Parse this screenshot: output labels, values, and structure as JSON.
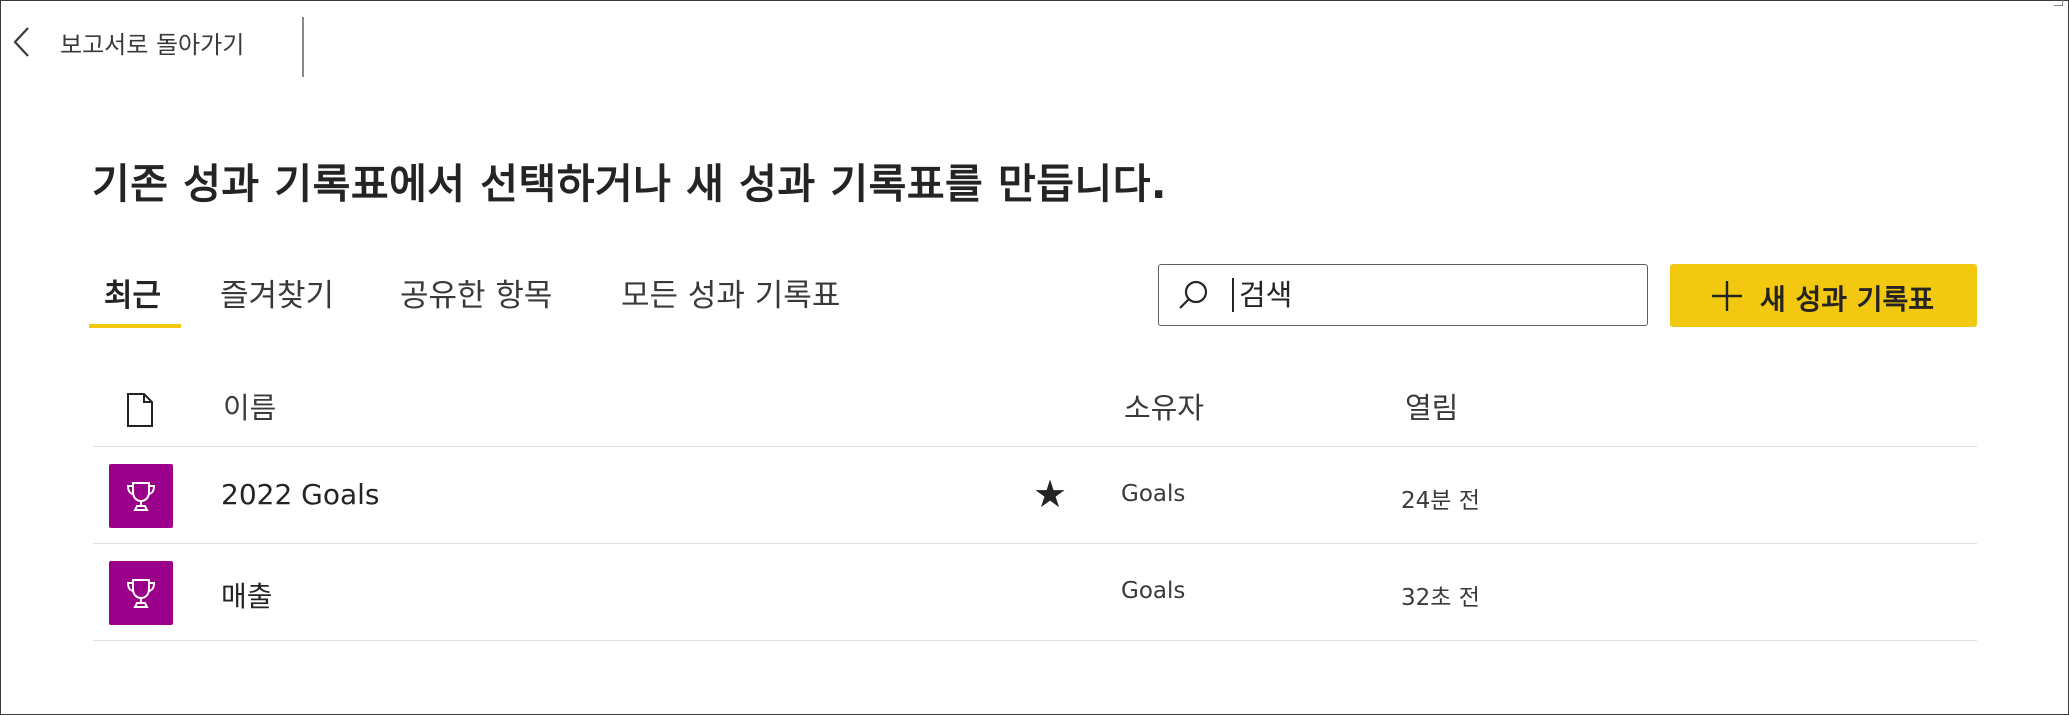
{
  "back": {
    "label": "보고서로 돌아가기",
    "icon": "chevron-left-icon"
  },
  "heading": "기존 성과 기록표에서 선택하거나 새 성과 기록표를 만듭니다.",
  "tabs": [
    {
      "label": "최근",
      "active": true
    },
    {
      "label": "즐겨찾기",
      "active": false
    },
    {
      "label": "공유한 항목",
      "active": false
    },
    {
      "label": "모든 성과 기록표",
      "active": false
    }
  ],
  "search": {
    "placeholder": "검색",
    "value": "",
    "icon": "search-icon"
  },
  "new_button": {
    "label": "새 성과 기록표",
    "icon": "plus-icon"
  },
  "table": {
    "columns": {
      "icon": "file-icon",
      "name": "이름",
      "owner": "소유자",
      "opened": "열림"
    },
    "rows": [
      {
        "icon": "trophy-icon",
        "name": "2022 Goals",
        "favorite": true,
        "owner": "Goals",
        "opened": "24분 전"
      },
      {
        "icon": "trophy-icon",
        "name": "매출",
        "favorite": false,
        "owner": "Goals",
        "opened": "32초 전"
      }
    ]
  },
  "colors": {
    "accent": "#f2c811",
    "tile": "#9a0089",
    "text": "#252423"
  }
}
